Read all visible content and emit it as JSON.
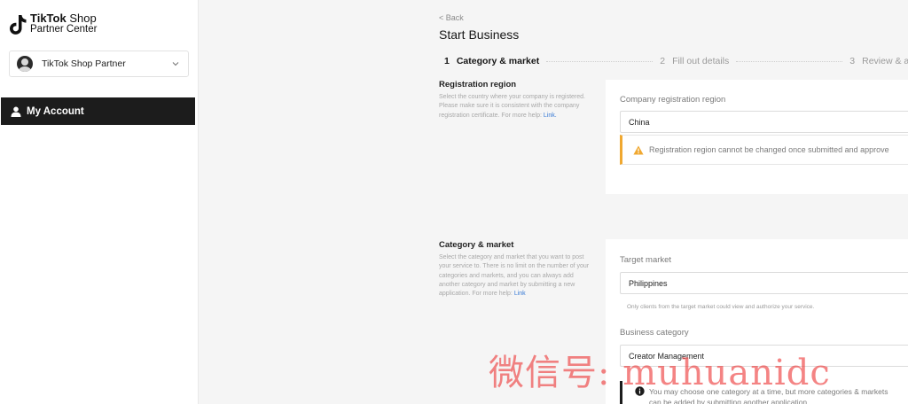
{
  "brand": {
    "line1_bold": "TikTok",
    "line1_rest": " Shop",
    "line2": "Partner Center"
  },
  "account_selector": {
    "name": "TikTok Shop Partner",
    "icon": "chevron-down-icon"
  },
  "nav": {
    "active_label": "My Account",
    "icon": "user-icon"
  },
  "header": {
    "back_label": "< Back",
    "title": "Start Business"
  },
  "steps": [
    {
      "num": "1",
      "label": "Category & market",
      "state": "active"
    },
    {
      "num": "2",
      "label": "Fill out details",
      "state": "inactive"
    },
    {
      "num": "3",
      "label": "Review & app",
      "state": "inactive"
    }
  ],
  "registration": {
    "title": "Registration region",
    "desc": "Select the country where your company is registered. Please make sure it is consistent with the company registration certificate. For more help: ",
    "link": "Link.",
    "field_label": "Company registration region",
    "value": "China",
    "warning": "Registration region cannot be changed once submitted and approve"
  },
  "category_market": {
    "title": "Category & market",
    "desc": "Select the category and market that you want to post your service to. There is no limit on the number of your categories and markets, and you can always add another category and market by submitting a new application. For more help: ",
    "link": "Link",
    "market_label": "Target market",
    "market_value": "Philippines",
    "market_hint": "Only clients from the target market could view and authorize your service.",
    "category_label": "Business category",
    "category_value": "Creator Management",
    "info": "You may choose one category at a time, but more categories & markets can be added by submitting another application."
  },
  "watermark": "微信号: muhuanidc",
  "colors": {
    "nav_bg": "#1c1c1c",
    "warning_accent": "#f0a830",
    "link": "#3a7bd5",
    "watermark": "#ee3a3a"
  }
}
